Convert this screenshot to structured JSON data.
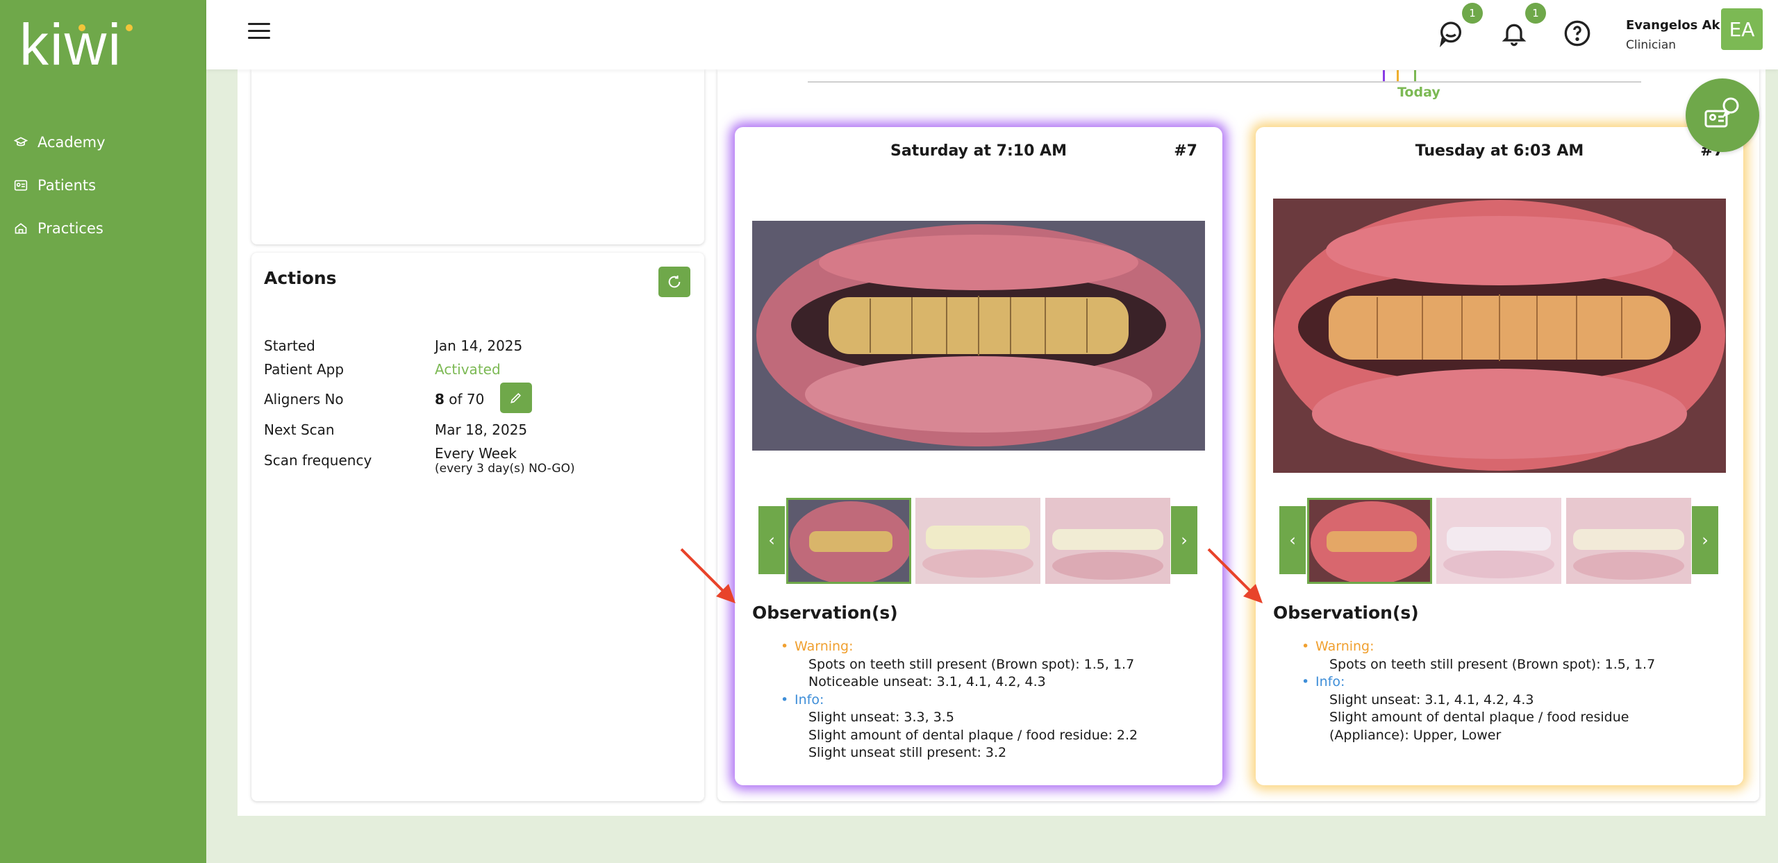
{
  "brand": {
    "logo_text": "kiwi",
    "accent": "#6fa84a"
  },
  "sidebar": {
    "items": [
      {
        "label": "Academy",
        "icon": "graduation-cap-icon"
      },
      {
        "label": "Patients",
        "icon": "id-card-icon"
      },
      {
        "label": "Practices",
        "icon": "home-icon"
      }
    ]
  },
  "header": {
    "messages_badge": "1",
    "notifications_badge": "1",
    "user_name": "Evangelos Akli",
    "user_role": "Clinician",
    "avatar_initials": "EA"
  },
  "actions": {
    "title": "Actions",
    "started_label": "Started",
    "started_value": "Jan 14, 2025",
    "app_label": "Patient App",
    "app_value": "Activated",
    "aligners_label": "Aligners No",
    "aligners_current": "8",
    "aligners_total": " of 70",
    "next_scan_label": "Next Scan",
    "next_scan_value": "Mar 18, 2025",
    "frequency_label": "Scan frequency",
    "frequency_value": "Every Week",
    "frequency_sub": "(every 3 day(s) NO-GO)"
  },
  "timeline": {
    "today_label": "Today"
  },
  "scans": [
    {
      "title": "Saturday at 7:10 AM",
      "number": "#7",
      "obs_title": "Observation(s)",
      "warning_label": "Warning:",
      "warning_items": [
        "Spots on teeth still present (Brown spot): 1.5, 1.7",
        "Noticeable unseat: 3.1, 4.1, 4.2, 4.3"
      ],
      "info_label": "Info:",
      "info_items": [
        "Slight unseat: 3.3, 3.5",
        "Slight amount of dental plaque / food residue: 2.2",
        "Slight unseat still present: 3.2"
      ]
    },
    {
      "title": "Tuesday at 6:03 AM",
      "number": "#7",
      "obs_title": "Observation(s)",
      "warning_label": "Warning:",
      "warning_items": [
        "Spots on teeth still present (Brown spot): 1.5, 1.7"
      ],
      "info_label": "Info:",
      "info_items": [
        "Slight unseat: 3.1, 4.1, 4.2, 4.3",
        "Slight amount of dental plaque / food residue",
        "(Appliance): Upper, Lower"
      ]
    }
  ]
}
